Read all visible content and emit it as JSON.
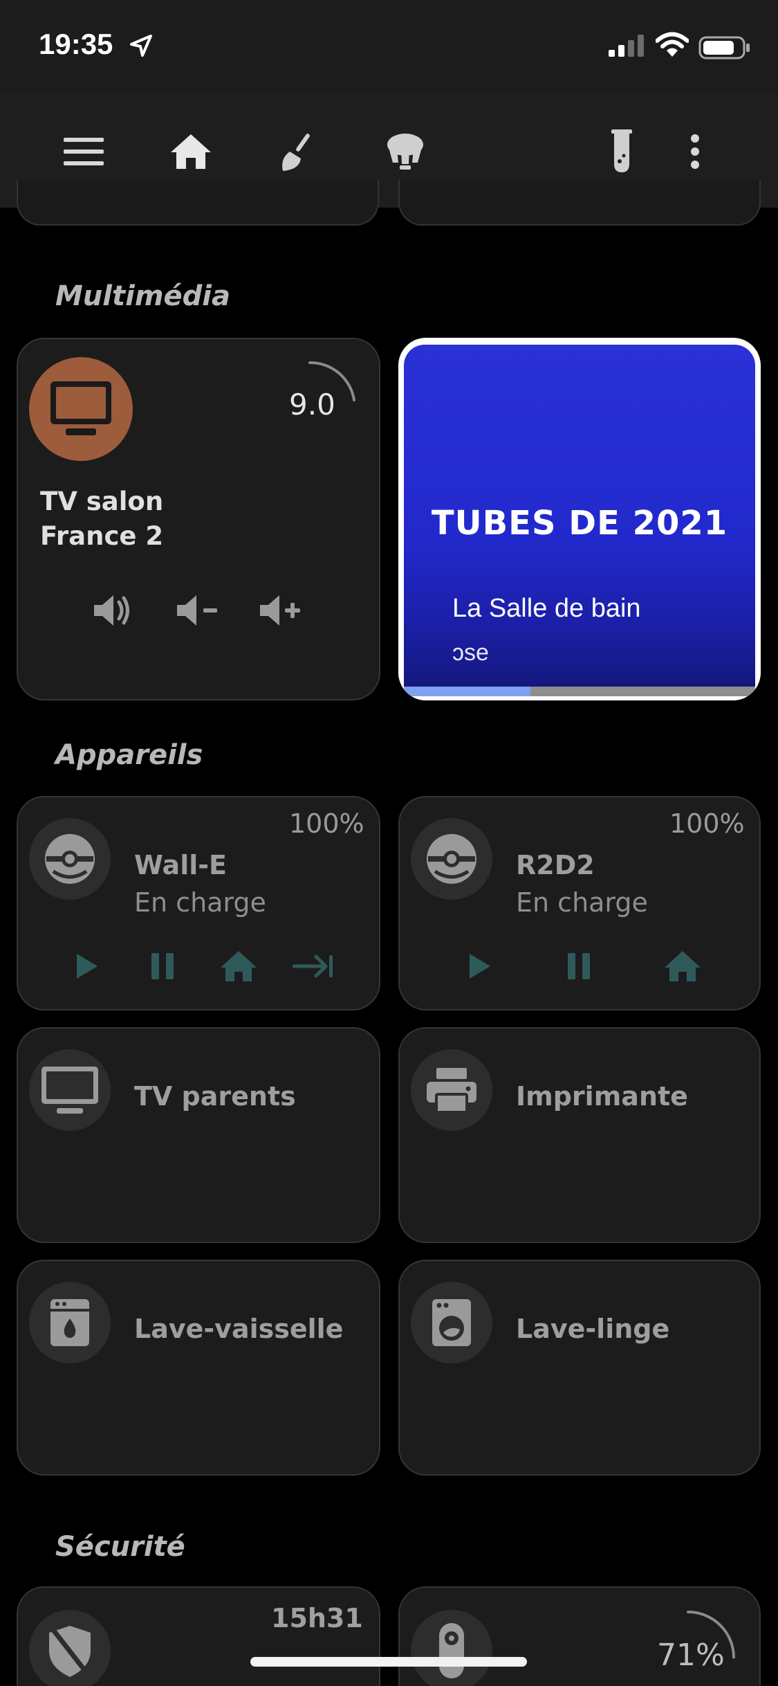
{
  "status_bar": {
    "time": "19:35"
  },
  "toolbar": {
    "icons": [
      "menu-icon",
      "home-icon",
      "broom-icon",
      "lamp-icon",
      "test-tube-icon",
      "more-vertical-icon"
    ],
    "active_tab": "home"
  },
  "sections": {
    "multimedia": "Multimédia",
    "appareils": "Appareils",
    "securite": "Sécurité"
  },
  "tv_salon": {
    "volume": "9.0",
    "name": "TV salon",
    "source": "France 2",
    "controls": [
      "volume-mute-icon",
      "volume-down-icon",
      "volume-up-icon"
    ]
  },
  "media_player": {
    "artwork_text": "TUBES DE 2021",
    "title": "La Salle de bain",
    "subtitle": "ɔse",
    "progress": 0.36,
    "colors": {
      "artwork": "#2229cc",
      "progress": "#7ea2f0"
    }
  },
  "devices": {
    "wall_e": {
      "battery": "100%",
      "name": "Wall-E",
      "status": "En charge"
    },
    "r2d2": {
      "battery": "100%",
      "name": "R2D2",
      "status": "En charge"
    },
    "tv_parents": {
      "name": "TV parents"
    },
    "imprimante": {
      "name": "Imprimante"
    },
    "lave_vaisselle": {
      "name": "Lave-vaisselle"
    },
    "lave_linge": {
      "name": "Lave-linge"
    }
  },
  "security": {
    "alarm_time": "15h31",
    "sensor_percent": "71%",
    "sensor_level": 0.71
  },
  "colors": {
    "accent_tv": "#9d5c3c",
    "vacuum_controls": "#2f5a5a",
    "background": "#000000",
    "card": "#1c1c1c"
  }
}
